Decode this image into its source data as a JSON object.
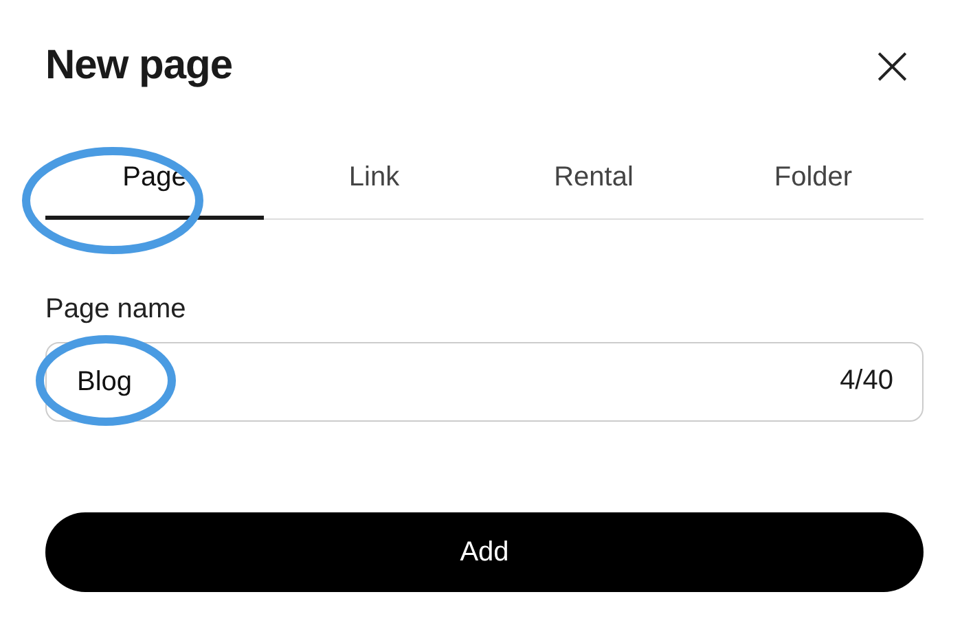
{
  "dialog": {
    "title": "New page",
    "close": "×"
  },
  "tabs": [
    {
      "label": "Page",
      "selected": true,
      "circled": true
    },
    {
      "label": "Link",
      "selected": false,
      "circled": false
    },
    {
      "label": "Rental",
      "selected": false,
      "circled": false
    },
    {
      "label": "Folder",
      "selected": false,
      "circled": false
    }
  ],
  "field": {
    "label": "Page name",
    "value": "Blog",
    "counter": "4/40",
    "circled": true
  },
  "buttons": [
    {
      "label": "Add"
    }
  ]
}
